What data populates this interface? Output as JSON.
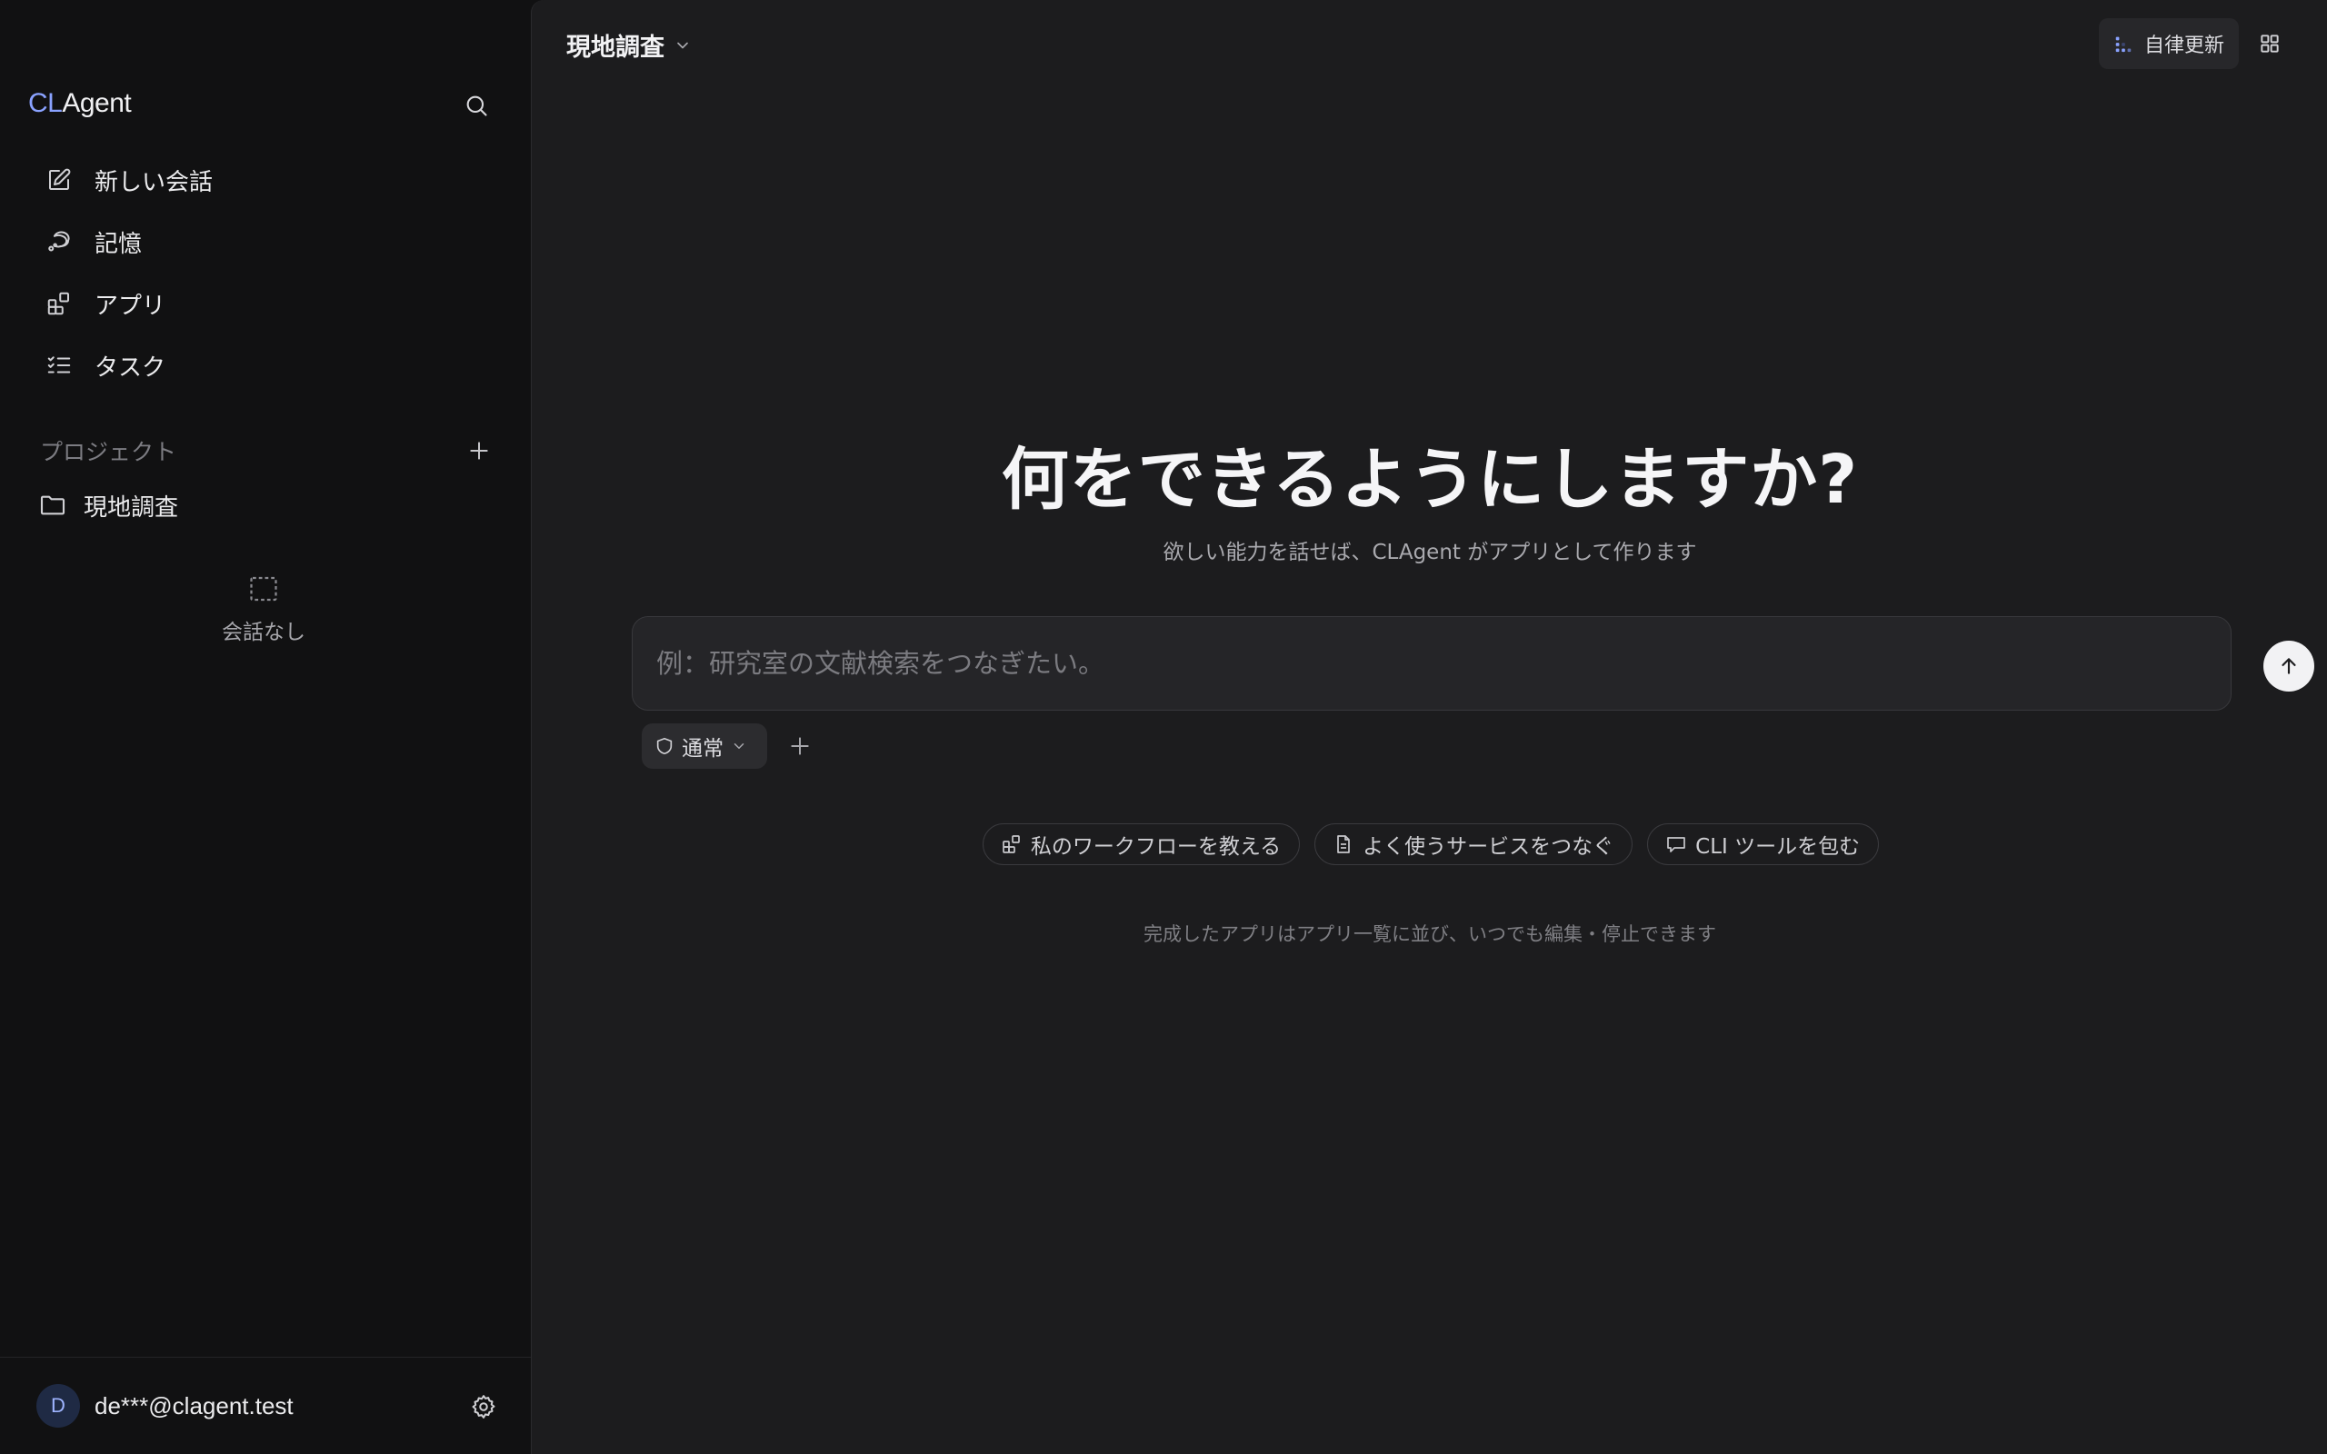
{
  "sidebar": {
    "brand_prefix": "CL",
    "brand_suffix": "Agent",
    "nav": [
      {
        "label": "新しい会話",
        "icon": "new-chat-icon"
      },
      {
        "label": "記憶",
        "icon": "memory-icon"
      },
      {
        "label": "アプリ",
        "icon": "apps-icon"
      },
      {
        "label": "タスク",
        "icon": "tasks-icon"
      }
    ],
    "projects_label": "プロジェクト",
    "projects": [
      {
        "label": "現地調査",
        "icon": "folder-icon"
      }
    ],
    "empty_label": "会話なし",
    "user": {
      "initial": "D",
      "email": "de***@clagent.test"
    }
  },
  "header": {
    "project_title": "現地調査",
    "auto_update_label": "自律更新"
  },
  "main": {
    "headline": "何をできるようにしますか?",
    "subline": "欲しい能力を話せば、CLAgent がアプリとして作ります",
    "input_placeholder": "例：研究室の文献検索をつなぎたい。",
    "mode_label": "通常",
    "suggestions": [
      {
        "label": "私のワークフローを教える",
        "icon": "apps-icon"
      },
      {
        "label": "よく使うサービスをつなぐ",
        "icon": "document-icon"
      },
      {
        "label": "CLI ツールを包む",
        "icon": "terminal-chat-icon"
      }
    ],
    "footnote": "完成したアプリはアプリ一覧に並び、いつでも編集・停止できます"
  },
  "colors": {
    "accent": "#8aa2ff",
    "sidebar_bg": "#111112",
    "main_bg": "#1c1c1e",
    "input_bg": "#252528"
  }
}
